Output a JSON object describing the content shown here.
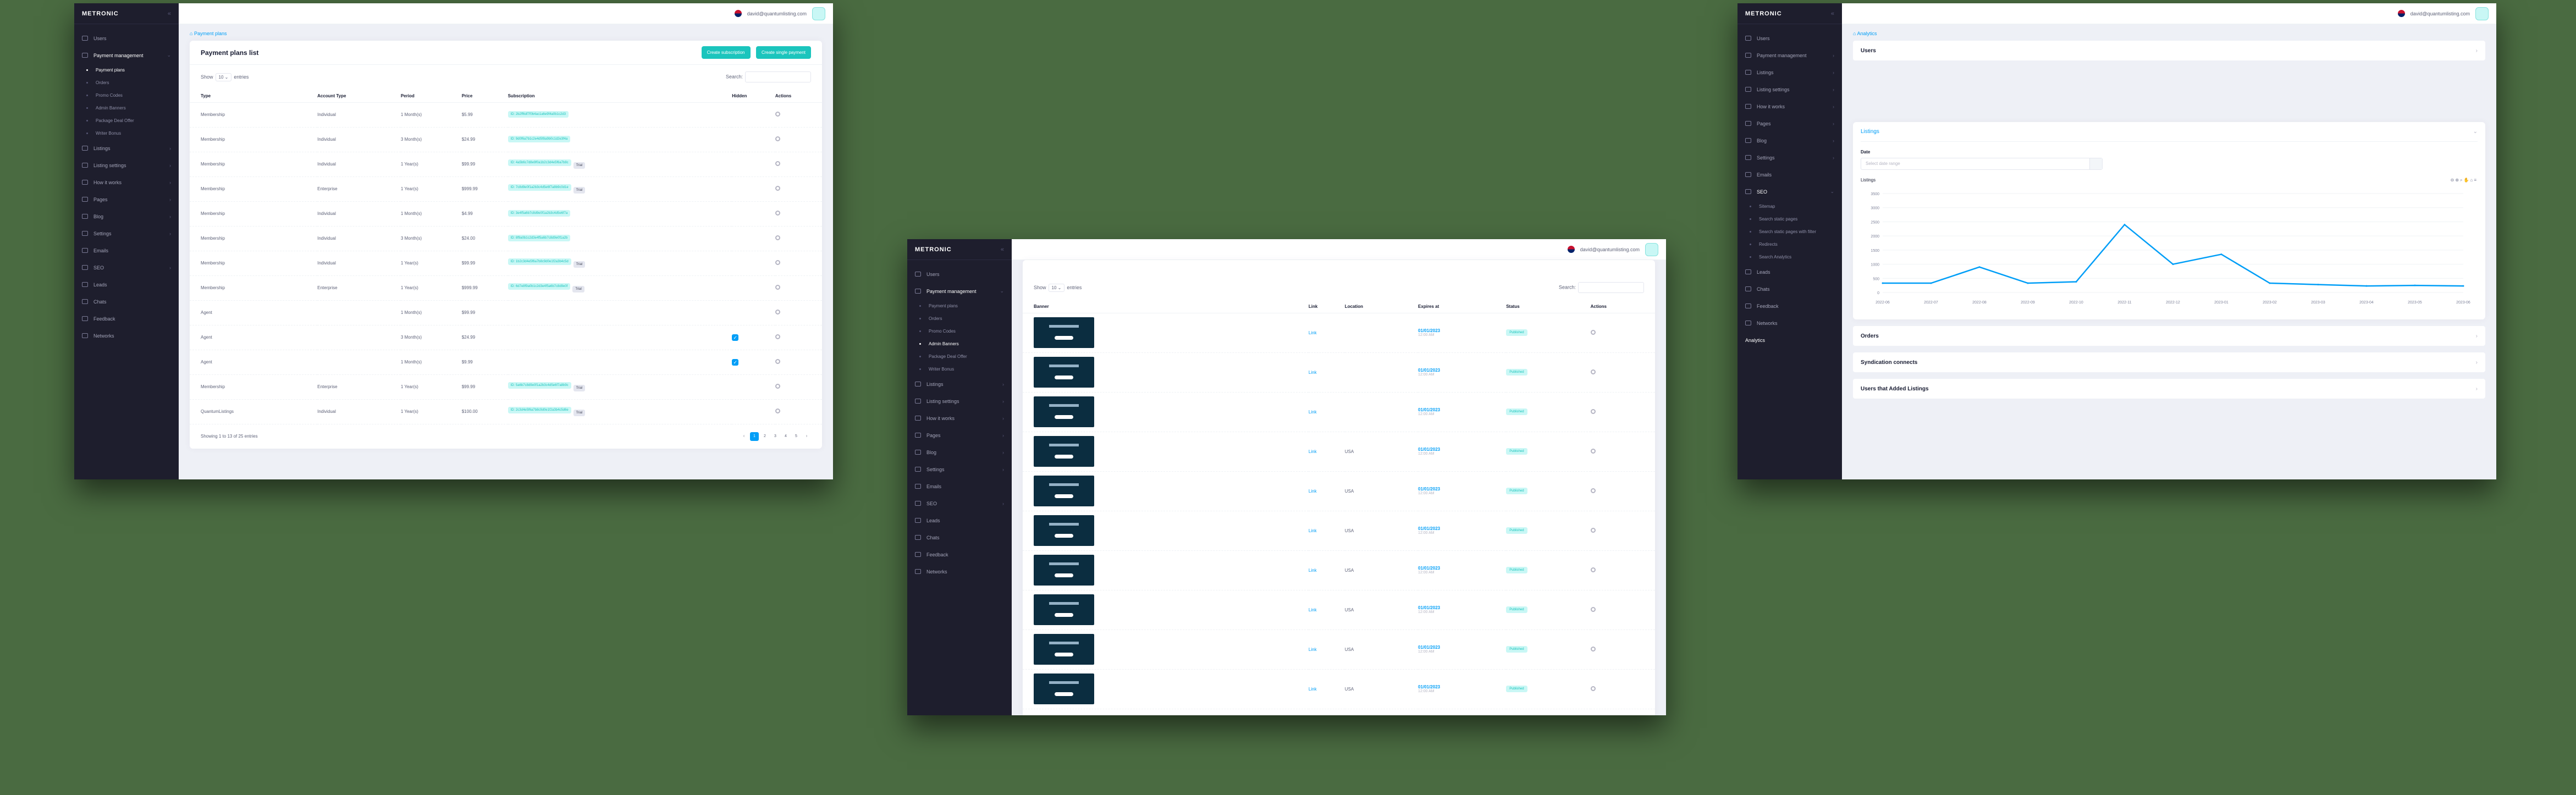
{
  "colors": {
    "sidebar": "#1e1e2d",
    "accent": "#009ef7",
    "teal": "#1bc5bd",
    "background": "#4a6b41"
  },
  "common": {
    "logo": "METRONIC",
    "user_email": "david@quantumlisting.com",
    "collapse_icon": "double-chevron-left-icon"
  },
  "shot1": {
    "sidebar": [
      {
        "label": "Users",
        "icon": "users-icon"
      },
      {
        "label": "Payment management",
        "icon": "card-icon",
        "active": true,
        "chevron": "⌄"
      },
      {
        "label": "Payment plans",
        "sub": true,
        "current": true
      },
      {
        "label": "Orders",
        "sub": true
      },
      {
        "label": "Promo Codes",
        "sub": true
      },
      {
        "label": "Admin Banners",
        "sub": true
      },
      {
        "label": "Package Deal Offer",
        "sub": true
      },
      {
        "label": "Writer Bonus",
        "sub": true
      },
      {
        "label": "Listings",
        "icon": "list-icon",
        "chevron": "›"
      },
      {
        "label": "Listing settings",
        "icon": "settings-icon",
        "chevron": "›"
      },
      {
        "label": "How it works",
        "icon": "question-icon",
        "chevron": "›"
      },
      {
        "label": "Pages",
        "icon": "file-icon",
        "chevron": "›"
      },
      {
        "label": "Blog",
        "icon": "blog-icon",
        "chevron": "›"
      },
      {
        "label": "Settings",
        "icon": "gear-icon",
        "chevron": "›"
      },
      {
        "label": "Emails",
        "icon": "mail-icon"
      },
      {
        "label": "SEO",
        "icon": "seo-icon",
        "chevron": "›"
      },
      {
        "label": "Leads",
        "icon": "search-icon"
      },
      {
        "label": "Chats",
        "icon": "chat-icon"
      },
      {
        "label": "Feedback",
        "icon": "feedback-icon"
      },
      {
        "label": "Networks",
        "icon": "network-icon"
      }
    ],
    "breadcrumb": "Payment plans",
    "card_title": "Payment plans list",
    "btn_subscription": "Create subscription",
    "btn_single": "Create single payment",
    "show_label": "Show",
    "show_value": "10",
    "entries_label": "entries",
    "search_label": "Search:",
    "headers": [
      "Type",
      "Account Type",
      "Period",
      "Price",
      "Subscription",
      "Hidden",
      "Actions"
    ],
    "rows": [
      {
        "type": "Membership",
        "account": "Individual",
        "period": "1 Month(s)",
        "price": "$5.99",
        "sub": "ID: 2b2ff6df7f0b4ac1a6e9f4a0b1c2d3",
        "trial": "",
        "hidden": false
      },
      {
        "type": "Membership",
        "account": "Individual",
        "period": "3 Month(s)",
        "price": "$24.99",
        "sub": "ID: 9d0f6a7b1c2e4d5f8a9b0c1d2e3f4a",
        "trial": "",
        "hidden": false
      },
      {
        "type": "Membership",
        "account": "Individual",
        "period": "1 Year(s)",
        "price": "$99.99",
        "sub": "ID: 4a5b6c7d8e9f0a1b2c3d4e5f6a7b8c",
        "trial": "Trial",
        "hidden": false
      },
      {
        "type": "Membership",
        "account": "Enterprise",
        "period": "1 Year(s)",
        "price": "$999.99",
        "sub": "ID: 7c8d9e0f1a2b3c4d5e6f7a8b9c0d1e",
        "trial": "Trial",
        "hidden": false
      },
      {
        "type": "Membership",
        "account": "Individual",
        "period": "1 Month(s)",
        "price": "$4.99",
        "sub": "ID: 3e4f5a6b7c8d9e0f1a2b3c4d5e6f7a",
        "trial": "",
        "hidden": false
      },
      {
        "type": "Membership",
        "account": "Individual",
        "period": "3 Month(s)",
        "price": "$24.00",
        "sub": "ID: 8f9a0b1c2d3e4f5a6b7c8d9e0f1a2b",
        "trial": "",
        "hidden": false
      },
      {
        "type": "Membership",
        "account": "Individual",
        "period": "1 Year(s)",
        "price": "$99.99",
        "sub": "ID: 1b2c3d4e5f6a7b8c9d0e1f2a3b4c5d",
        "trial": "Trial",
        "hidden": false
      },
      {
        "type": "Membership",
        "account": "Enterprise",
        "period": "1 Year(s)",
        "price": "$999.99",
        "sub": "ID: 6d7e8f9a0b1c2d3e4f5a6b7c8d9e0f",
        "trial": "Trial",
        "hidden": false
      },
      {
        "type": "Agent",
        "account": "",
        "period": "1 Month(s)",
        "price": "$99.99",
        "sub": "",
        "trial": "",
        "hidden": false
      },
      {
        "type": "Agent",
        "account": "",
        "period": "3 Month(s)",
        "price": "$24.99",
        "sub": "",
        "trial": "",
        "hidden": true
      },
      {
        "type": "Agent",
        "account": "",
        "period": "1 Month(s)",
        "price": "$9.99",
        "sub": "",
        "trial": "",
        "hidden": true
      },
      {
        "type": "Membership",
        "account": "Enterprise",
        "period": "1 Year(s)",
        "price": "$99.99",
        "sub": "ID: 5a6b7c8d9e0f1a2b3c4d5e6f7a8b9c",
        "trial": "Trial",
        "hidden": false
      },
      {
        "type": "QuantumListings",
        "account": "Individual",
        "period": "1 Year(s)",
        "price": "$100.00",
        "sub": "ID: 2c3d4e5f6a7b8c9d0e1f2a3b4c5d6e",
        "trial": "Trial",
        "hidden": false
      }
    ],
    "footer": "Showing 1 to 13 of 25 entries",
    "pages": [
      "‹",
      "1",
      "2",
      "3",
      "4",
      "5",
      "›"
    ]
  },
  "shot2": {
    "sidebar": [
      {
        "label": "Users",
        "icon": "users-icon"
      },
      {
        "label": "Payment management",
        "icon": "card-icon",
        "active": true,
        "chevron": "⌄"
      },
      {
        "label": "Payment plans",
        "sub": true
      },
      {
        "label": "Orders",
        "sub": true
      },
      {
        "label": "Promo Codes",
        "sub": true
      },
      {
        "label": "Admin Banners",
        "sub": true,
        "current": true
      },
      {
        "label": "Package Deal Offer",
        "sub": true
      },
      {
        "label": "Writer Bonus",
        "sub": true
      },
      {
        "label": "Listings",
        "icon": "list-icon",
        "chevron": "›"
      },
      {
        "label": "Listing settings",
        "icon": "settings-icon",
        "chevron": "›"
      },
      {
        "label": "How it works",
        "icon": "question-icon",
        "chevron": "›"
      },
      {
        "label": "Pages",
        "icon": "file-icon",
        "chevron": "›"
      },
      {
        "label": "Blog",
        "icon": "blog-icon",
        "chevron": "›"
      },
      {
        "label": "Settings",
        "icon": "gear-icon",
        "chevron": "›"
      },
      {
        "label": "Emails",
        "icon": "mail-icon"
      },
      {
        "label": "SEO",
        "icon": "seo-icon",
        "chevron": "›"
      },
      {
        "label": "Leads",
        "icon": "search-icon"
      },
      {
        "label": "Chats",
        "icon": "chat-icon"
      },
      {
        "label": "Feedback",
        "icon": "feedback-icon"
      },
      {
        "label": "Networks",
        "icon": "network-icon"
      }
    ],
    "show_label": "Show",
    "show_value": "10",
    "entries_label": "entries",
    "search_label": "Search:",
    "headers": [
      "Banner",
      "Link",
      "Location",
      "Expires at",
      "Status",
      "Actions"
    ],
    "rows": [
      {
        "link": "Link",
        "location": "",
        "date": "01/01/2023",
        "time": "12:00 AM",
        "status": "Published"
      },
      {
        "link": "Link",
        "location": "",
        "date": "01/01/2023",
        "time": "12:00 AM",
        "status": "Published"
      },
      {
        "link": "Link",
        "location": "",
        "date": "01/01/2023",
        "time": "12:00 AM",
        "status": "Published"
      },
      {
        "link": "Link",
        "location": "USA",
        "date": "01/01/2023",
        "time": "12:00 AM",
        "status": "Published"
      },
      {
        "link": "Link",
        "location": "USA",
        "date": "01/01/2023",
        "time": "12:00 AM",
        "status": "Published"
      },
      {
        "link": "Link",
        "location": "USA",
        "date": "01/01/2023",
        "time": "12:00 AM",
        "status": "Published"
      },
      {
        "link": "Link",
        "location": "USA",
        "date": "01/01/2023",
        "time": "12:00 AM",
        "status": "Published"
      },
      {
        "link": "Link",
        "location": "USA",
        "date": "01/01/2023",
        "time": "12:00 AM",
        "status": "Published"
      },
      {
        "link": "Link",
        "location": "USA",
        "date": "01/01/2023",
        "time": "12:00 AM",
        "status": "Published"
      },
      {
        "link": "Link",
        "location": "USA",
        "date": "01/01/2023",
        "time": "12:00 AM",
        "status": "Published"
      }
    ]
  },
  "shot3": {
    "sidebar": [
      {
        "label": "Users",
        "icon": "users-icon"
      },
      {
        "label": "Payment management",
        "icon": "card-icon",
        "chevron": "›"
      },
      {
        "label": "Listings",
        "icon": "list-icon",
        "chevron": "›"
      },
      {
        "label": "Listing settings",
        "icon": "settings-icon",
        "chevron": "›"
      },
      {
        "label": "How it works",
        "icon": "question-icon",
        "chevron": "›"
      },
      {
        "label": "Pages",
        "icon": "file-icon",
        "chevron": "›"
      },
      {
        "label": "Blog",
        "icon": "blog-icon",
        "chevron": "›"
      },
      {
        "label": "Settings",
        "icon": "gear-icon",
        "chevron": "›"
      },
      {
        "label": "Emails",
        "icon": "mail-icon"
      },
      {
        "label": "SEO",
        "icon": "seo-icon",
        "active": true,
        "chevron": "⌄"
      },
      {
        "label": "Sitemap",
        "sub": true
      },
      {
        "label": "Search static pages",
        "sub": true
      },
      {
        "label": "Search static pages with filter",
        "sub": true
      },
      {
        "label": "Redirects",
        "sub": true
      },
      {
        "label": "Search Analytics",
        "sub": true
      },
      {
        "label": "Leads",
        "icon": "search-icon"
      },
      {
        "label": "Chats",
        "icon": "chat-icon"
      },
      {
        "label": "Feedback",
        "icon": "feedback-icon"
      },
      {
        "label": "Networks",
        "icon": "network-icon"
      },
      {
        "label": "Analytics",
        "icon": "",
        "current": true
      }
    ],
    "breadcrumb": "Analytics",
    "acc_users": "Users",
    "acc_listings": "Listings",
    "date_label": "Date",
    "date_placeholder": "Select date range",
    "acc_orders": "Orders",
    "acc_syndication": "Syndication connects",
    "acc_users_added": "Users that Added Listings"
  },
  "chart_data": {
    "type": "line",
    "title": "Listings",
    "x": [
      "2022-06",
      "2022-07",
      "2022-08",
      "2022-09",
      "2022-10",
      "2022-11",
      "2022-12",
      "2023-01",
      "2023-02",
      "2023-03",
      "2023-04",
      "2023-05",
      "2023-06"
    ],
    "series": [
      {
        "name": "",
        "values": [
          330,
          330,
          900,
          330,
          380,
          2400,
          1000,
          1350,
          330,
          280,
          230,
          250,
          230
        ]
      }
    ],
    "yticks": [
      0,
      500,
      1000,
      1500,
      2000,
      2500,
      3000,
      3500
    ],
    "ylim": [
      0,
      3500
    ],
    "grid": true,
    "color": "#009ef7"
  }
}
